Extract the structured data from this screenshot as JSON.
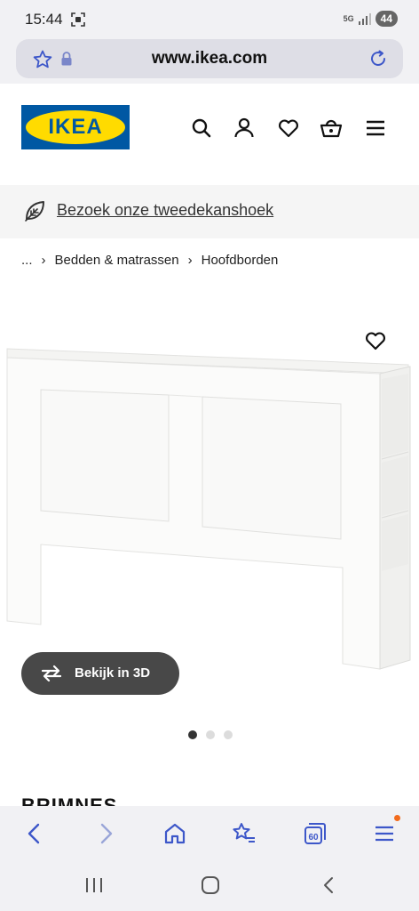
{
  "status_bar": {
    "time": "15:44",
    "network": "5G",
    "battery": "44"
  },
  "browser": {
    "url": "www.ikea.com",
    "tabs_count": "60"
  },
  "header": {
    "logo_text": "IKEA",
    "brand_color": "#0058a3",
    "logo_yellow": "#ffdb00"
  },
  "banner": {
    "text": "Bezoek onze tweedekanshoek"
  },
  "breadcrumb": {
    "items": [
      "...",
      "Bedden & matrassen",
      "Hoofdborden"
    ]
  },
  "product": {
    "view_3d_label": "Bekijk in 3D",
    "image_count": 3,
    "active_image": 1,
    "name_partial": "BRIMNES"
  },
  "icons": {
    "header": [
      "search-icon",
      "account-icon",
      "heart-icon",
      "basket-icon",
      "menu-icon"
    ],
    "browser_nav": [
      "back-icon",
      "forward-icon",
      "home-icon",
      "bookmarks-icon",
      "tabs-icon",
      "menu-icon"
    ]
  }
}
